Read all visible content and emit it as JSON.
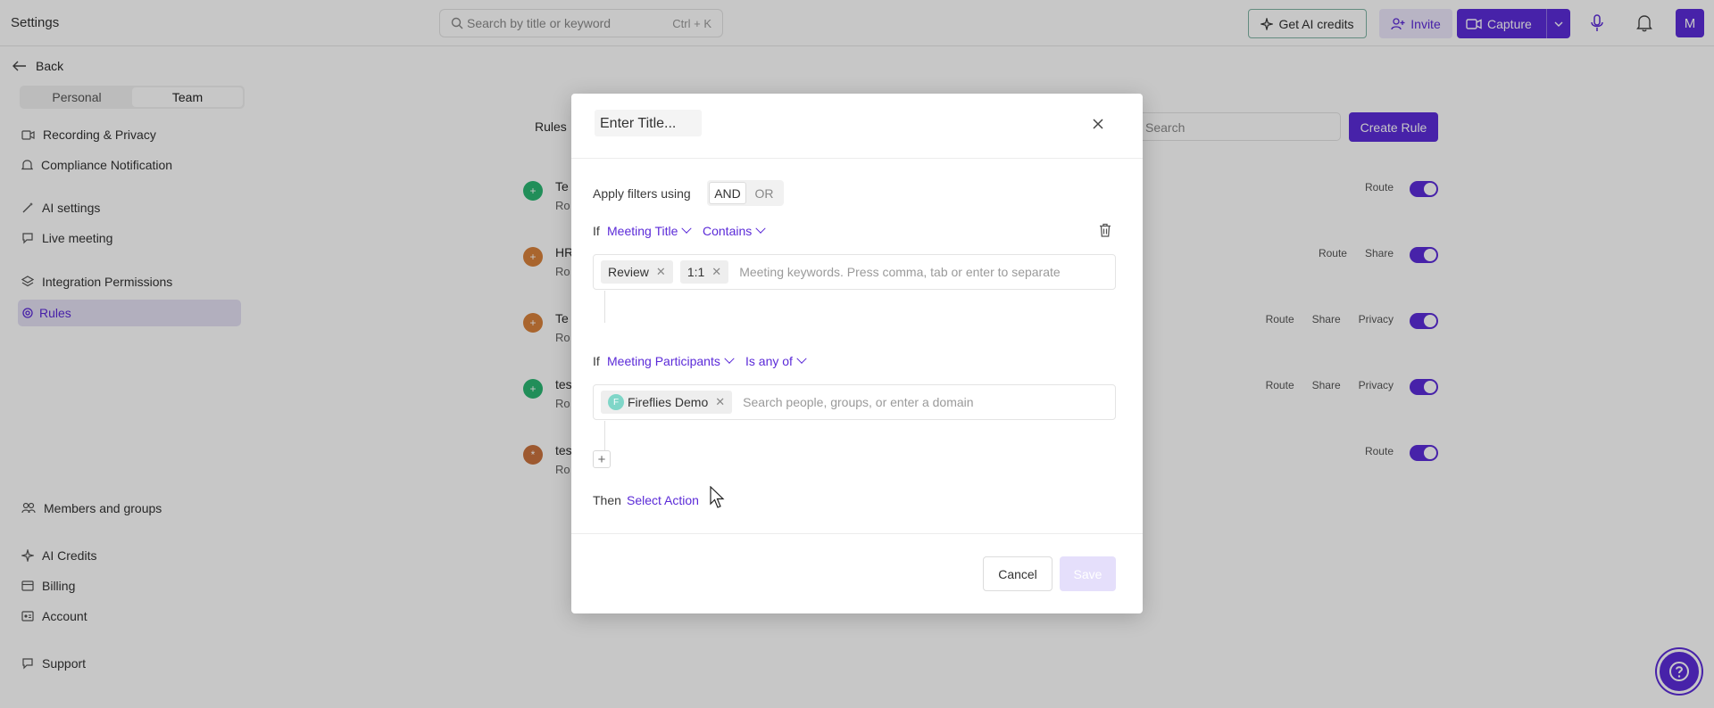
{
  "app": {
    "title": "Settings",
    "search_placeholder": "Search by title or keyword",
    "search_shortcut": "Ctrl + K",
    "get_credits": "Get AI credits",
    "invite": "Invite",
    "capture": "Capture",
    "avatar_initial": "M",
    "accent": "#5b2cd9"
  },
  "sidebar": {
    "back": "Back",
    "segments": [
      "Personal",
      "Team"
    ],
    "active_segment": "Team",
    "items": [
      {
        "label": "Recording & Privacy",
        "icon": "video-icon"
      },
      {
        "label": "Compliance Notification",
        "icon": "bell-icon"
      },
      {
        "label": "AI settings",
        "icon": "wand-icon"
      },
      {
        "label": "Live meeting",
        "icon": "chat-icon"
      },
      {
        "label": "Integration Permissions",
        "icon": "layers-icon"
      },
      {
        "label": "Rules",
        "icon": "rules-icon"
      },
      {
        "label": "Members and groups",
        "icon": "users-icon"
      },
      {
        "label": "AI Credits",
        "icon": "sparkle-icon"
      },
      {
        "label": "Billing",
        "icon": "billing-icon"
      },
      {
        "label": "Account",
        "icon": "account-icon"
      },
      {
        "label": "Support",
        "icon": "support-icon"
      }
    ]
  },
  "content": {
    "tab": "Rules",
    "search_placeholder": "Search",
    "create_rule": "Create Rule",
    "rules": [
      {
        "name": "Te",
        "sub": "Ro",
        "tags": [
          "Route"
        ],
        "color": "#2bb673"
      },
      {
        "name": "HR",
        "sub": "Ro",
        "tags": [
          "Route",
          "Share"
        ],
        "color": "#d9823b"
      },
      {
        "name": "Te",
        "sub": "Ro",
        "tags": [
          "Route",
          "Share",
          "Privacy"
        ],
        "color": "#d9823b"
      },
      {
        "name": "tes",
        "sub": "Ro",
        "tags": [
          "Route",
          "Share",
          "Privacy"
        ],
        "color": "#2bb673"
      },
      {
        "name": "tes",
        "sub": "Ro",
        "tags": [
          "Route"
        ],
        "color": "#c9733e"
      }
    ]
  },
  "modal": {
    "title": "Enter Title...",
    "apply_label": "Apply filters using",
    "and": "AND",
    "or": "OR",
    "if": "If",
    "cond1": {
      "field": "Meeting Title",
      "op": "Contains",
      "chips": [
        "Review",
        "1:1"
      ],
      "placeholder": "Meeting keywords. Press comma, tab or enter to separate"
    },
    "cond2": {
      "field": "Meeting Participants",
      "op": "Is any of",
      "chips": [
        "Fireflies Demo"
      ],
      "chip_avatar": "F",
      "placeholder": "Search people, groups, or enter a domain"
    },
    "then": "Then",
    "select_action": "Select Action",
    "cancel": "Cancel",
    "save": "Save"
  }
}
